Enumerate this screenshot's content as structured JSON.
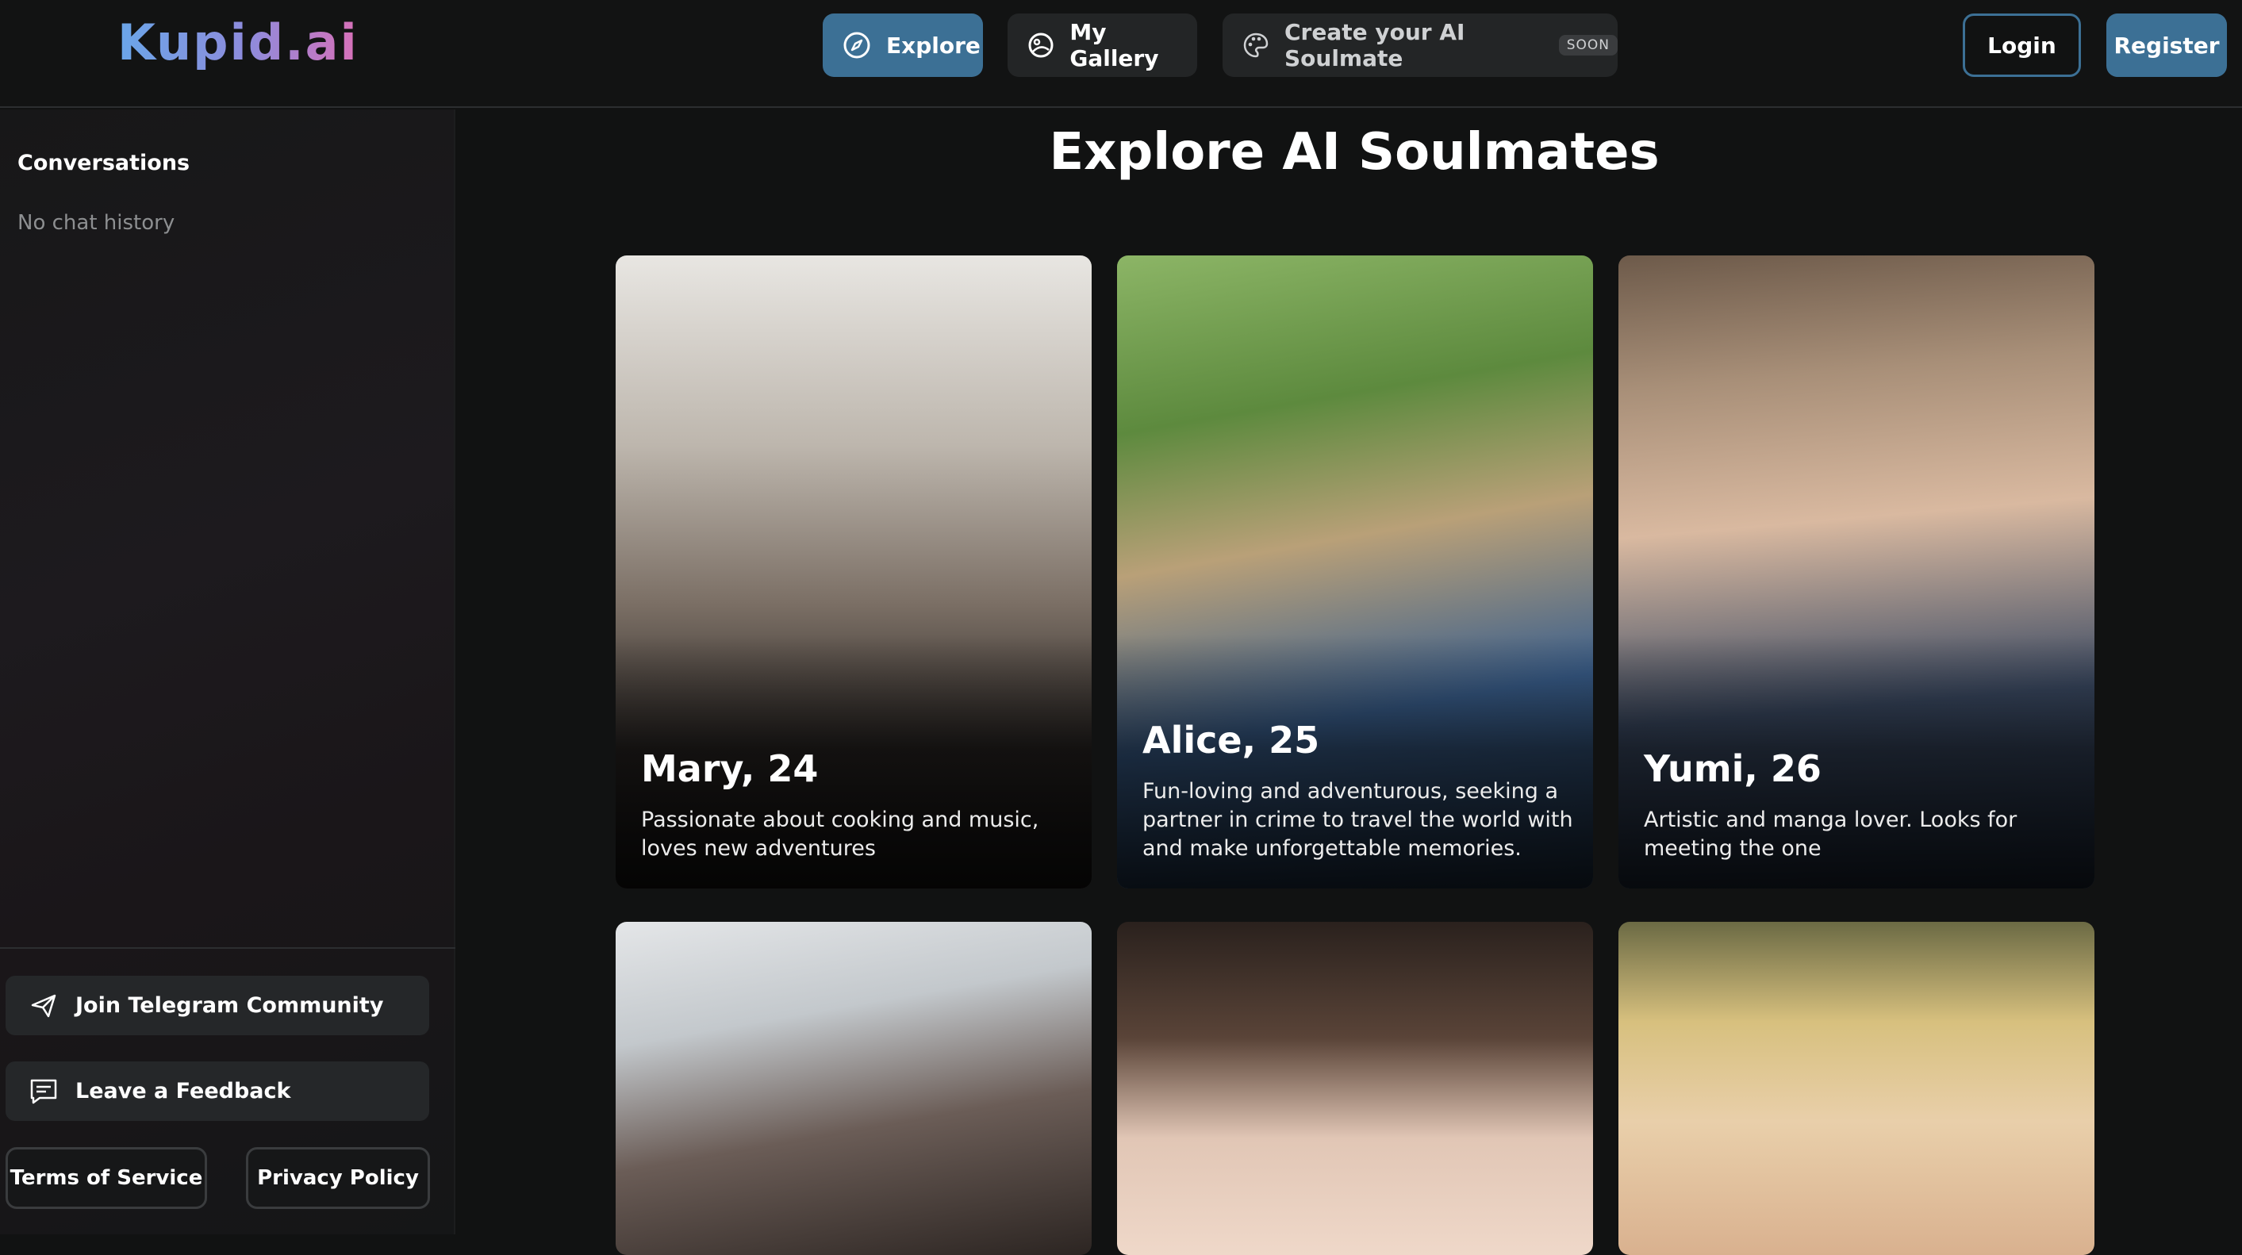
{
  "header": {
    "logo": "Kupid.ai",
    "nav": {
      "explore": "Explore",
      "gallery": "My Gallery",
      "create": "Create your AI Soulmate",
      "soon_badge": "SOON"
    },
    "login": "Login",
    "register": "Register"
  },
  "sidebar": {
    "title": "Conversations",
    "empty": "No chat history",
    "telegram": "Join Telegram Community",
    "feedback": "Leave a Feedback",
    "terms": "Terms of Service",
    "privacy": "Privacy Policy"
  },
  "main": {
    "title": "Explore AI Soulmates",
    "cards": [
      {
        "name": "Mary, 24",
        "desc": "Passionate about cooking and music, loves new adventures"
      },
      {
        "name": "Alice, 25",
        "desc": "Fun-loving and adventurous, seeking a partner in crime to travel the world with and make unforgettable memories."
      },
      {
        "name": "Yumi, 26",
        "desc": "Artistic and manga lover. Looks for meeting the one"
      }
    ]
  },
  "colors": {
    "accent": "#3c7095",
    "background": "#111212",
    "button_bg": "#232526"
  }
}
